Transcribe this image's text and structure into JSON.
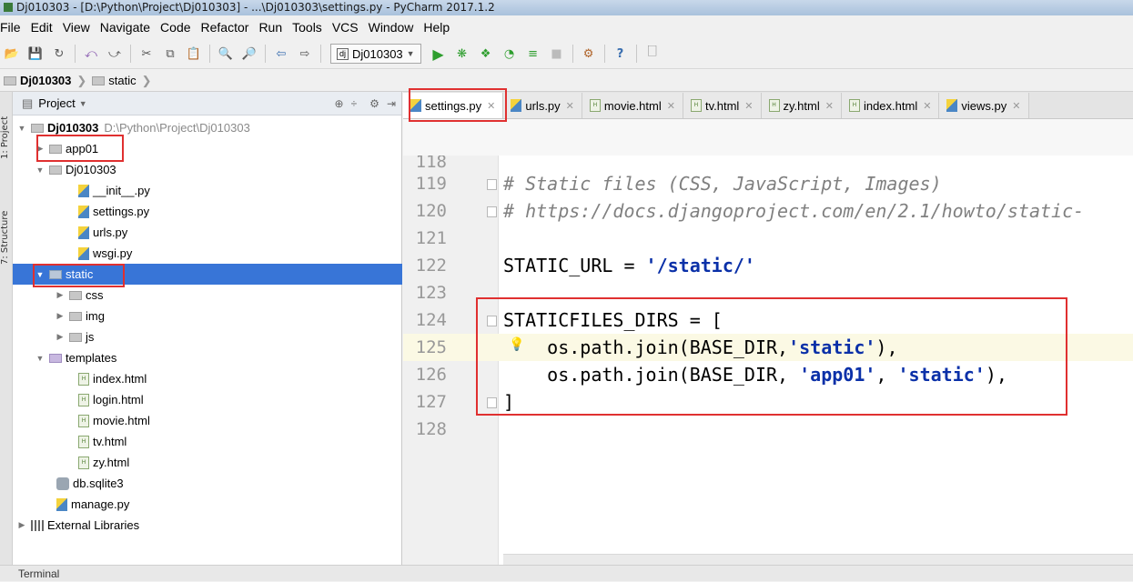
{
  "window": {
    "title": "Dj010303 - [D:\\Python\\Project\\Dj010303] - ...\\Dj010303\\settings.py - PyCharm 2017.1.2"
  },
  "menu": [
    "File",
    "Edit",
    "View",
    "Navigate",
    "Code",
    "Refactor",
    "Run",
    "Tools",
    "VCS",
    "Window",
    "Help"
  ],
  "toolbar": {
    "run_config": "Dj010303"
  },
  "breadcrumb": [
    "Dj010303",
    "static"
  ],
  "left_strip": {
    "project_tab": "1: Project",
    "structure_tab": "7: Structure"
  },
  "project_panel": {
    "header": "Project",
    "tree": [
      {
        "label": "Dj010303",
        "path": "D:\\Python\\Project\\Dj010303",
        "kind": "root"
      },
      {
        "label": "app01",
        "kind": "folder"
      },
      {
        "label": "Dj010303",
        "kind": "folder"
      },
      {
        "label": "__init__.py",
        "kind": "py"
      },
      {
        "label": "settings.py",
        "kind": "py"
      },
      {
        "label": "urls.py",
        "kind": "py"
      },
      {
        "label": "wsgi.py",
        "kind": "py"
      },
      {
        "label": "static",
        "kind": "folder"
      },
      {
        "label": "css",
        "kind": "folder"
      },
      {
        "label": "img",
        "kind": "folder"
      },
      {
        "label": "js",
        "kind": "folder"
      },
      {
        "label": "templates",
        "kind": "folder"
      },
      {
        "label": "index.html",
        "kind": "html"
      },
      {
        "label": "login.html",
        "kind": "html"
      },
      {
        "label": "movie.html",
        "kind": "html"
      },
      {
        "label": "tv.html",
        "kind": "html"
      },
      {
        "label": "zy.html",
        "kind": "html"
      },
      {
        "label": "db.sqlite3",
        "kind": "db"
      },
      {
        "label": "manage.py",
        "kind": "py"
      },
      {
        "label": "External Libraries",
        "kind": "lib"
      }
    ]
  },
  "tabs": [
    "settings.py",
    "urls.py",
    "movie.html",
    "tv.html",
    "zy.html",
    "index.html",
    "views.py"
  ],
  "editor": {
    "lines": [
      {
        "num": "118",
        "text": ""
      },
      {
        "num": "119",
        "text": "# Static files (CSS, JavaScript, Images)"
      },
      {
        "num": "120",
        "text": "# https://docs.djangoproject.com/en/2.1/howto/static-"
      },
      {
        "num": "121",
        "text": ""
      },
      {
        "num": "122",
        "a": "STATIC_URL = ",
        "s": "'/static/'"
      },
      {
        "num": "123",
        "text": ""
      },
      {
        "num": "124",
        "text": "STATICFILES_DIRS = ["
      },
      {
        "num": "125",
        "a": "    os.path.join(BASE_DIR,",
        "s": "'static'",
        "b": "),"
      },
      {
        "num": "126",
        "a": "    os.path.join(BASE_DIR, ",
        "s": "'app01'",
        "b": ", ",
        "s2": "'static'",
        "c": "),"
      },
      {
        "num": "127",
        "text": "]"
      },
      {
        "num": "128",
        "text": ""
      }
    ]
  },
  "bottom": {
    "terminal": "Terminal"
  },
  "colors": {
    "selection": "#3875d7",
    "annotation": "#e03030",
    "string": "#0a30a8",
    "comment": "#808080"
  }
}
